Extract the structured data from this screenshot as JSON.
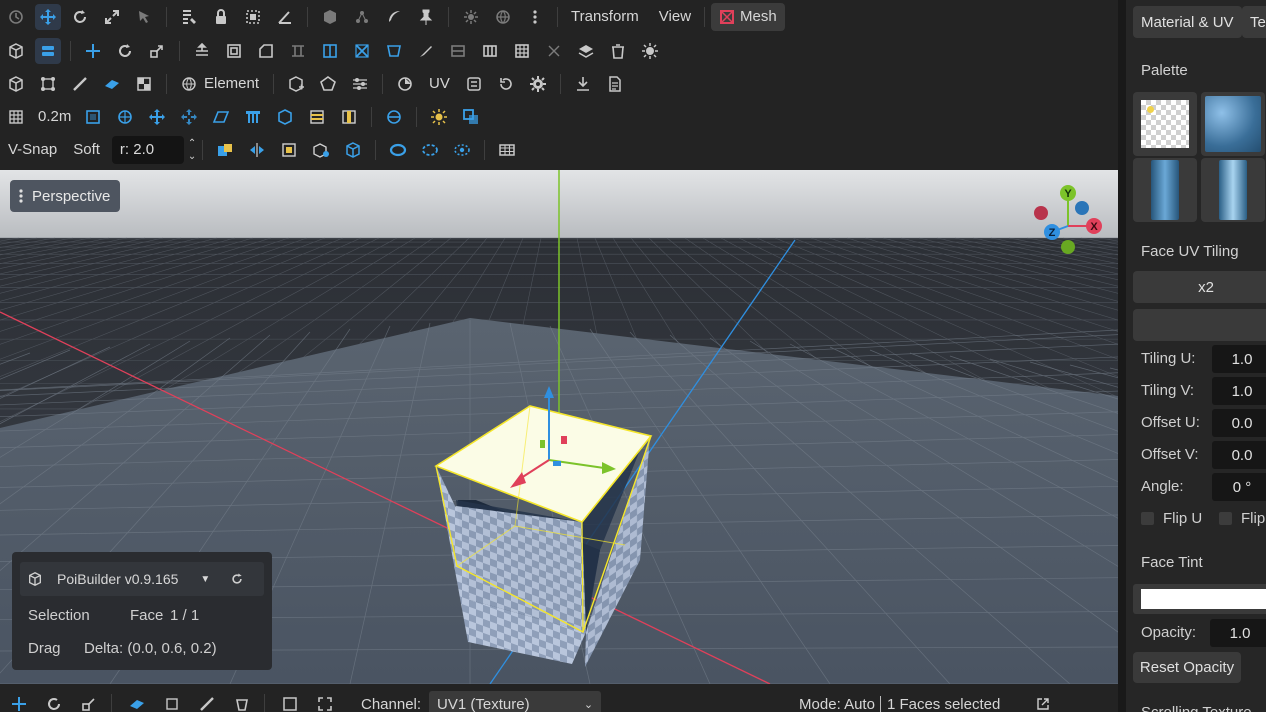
{
  "toolbar_top": {
    "menus": [
      "Transform",
      "View"
    ],
    "mesh_label": "Mesh"
  },
  "toolbar_row3": {
    "element_label": "Element",
    "uv_label": "UV"
  },
  "toolbar_row4": {
    "grid_size": "0.2m"
  },
  "toolbar_row5": {
    "vsnap_label": "V-Snap",
    "soft_label": "Soft",
    "radius_value": "r: 2.0"
  },
  "viewport": {
    "view_mode": "Perspective",
    "axis_labels": {
      "y": "Y",
      "x": "X",
      "z": "Z"
    },
    "colors": {
      "x_axis": "#e0405a",
      "y_axis": "#7cc32a",
      "z_axis": "#2f8fe0",
      "selection": "#f5e62a"
    }
  },
  "info_panel": {
    "title": "PoiBuilder v0.9.165",
    "selection_label": "Selection",
    "selection_type": "Face",
    "selection_count": "1 / 1",
    "drag_label": "Drag",
    "drag_delta": "Delta: (0.0, 0.6, 0.2)"
  },
  "bottom_bar": {
    "channel_label": "Channel:",
    "channel_value": "UV1 (Texture)",
    "mode_text": "Mode: Auto",
    "selection_status": "1 Faces selected"
  },
  "right_panel": {
    "tabs": [
      "Material & UV",
      "Te"
    ],
    "palette_title": "Palette",
    "uv_tiling_title": "Face UV Tiling",
    "tiling_button": "x2",
    "fields": [
      {
        "label": "Tiling U:",
        "value": "1.0"
      },
      {
        "label": "Tiling V:",
        "value": "1.0"
      },
      {
        "label": "Offset U:",
        "value": "0.0"
      },
      {
        "label": "Offset V:",
        "value": "0.0"
      },
      {
        "label": "Angle:",
        "value": "0 °"
      }
    ],
    "flip_u": "Flip U",
    "flip_v": "Flip",
    "tint_title": "Face Tint",
    "tint_color": "#ffffff",
    "opacity_label": "Opacity:",
    "opacity_value": "1.0",
    "reset_opacity": "Reset Opacity",
    "next_section": "Scrolling Texture"
  }
}
